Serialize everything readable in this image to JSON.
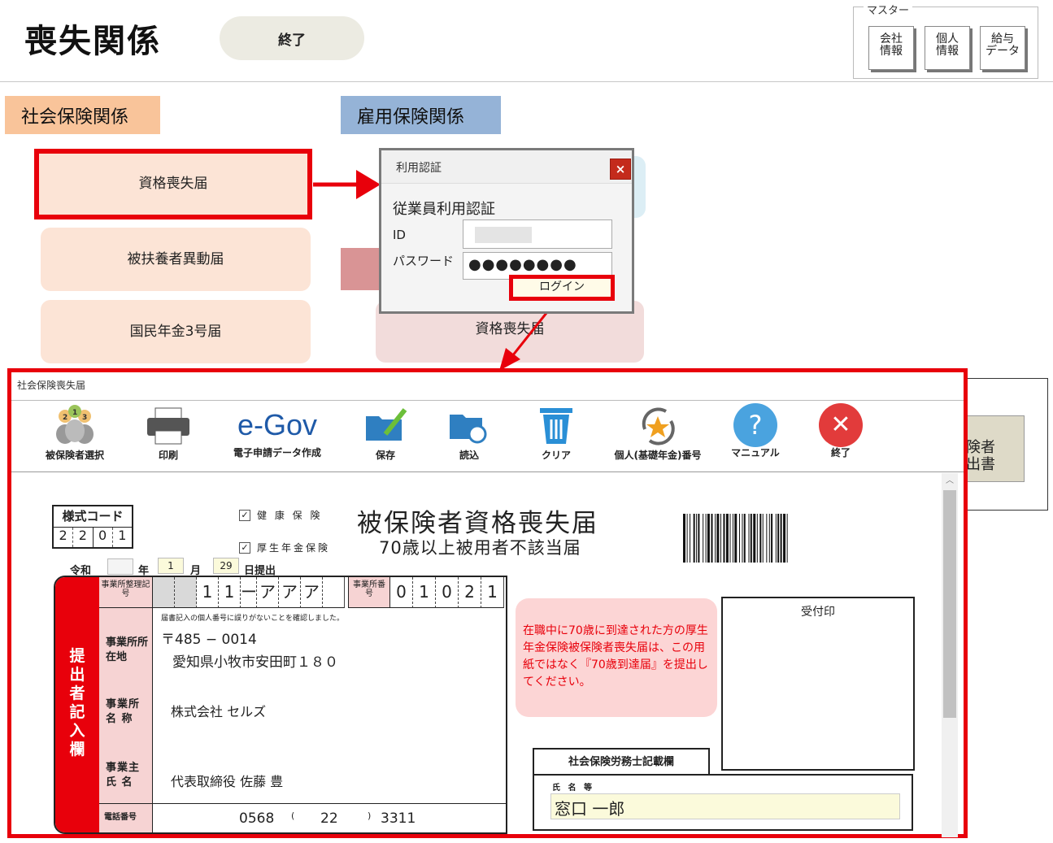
{
  "header": {
    "title": "喪失関係",
    "end_button": "終了",
    "master_label": "マスター",
    "master_buttons": [
      {
        "line1": "会社",
        "line2": "情報"
      },
      {
        "line1": "個人",
        "line2": "情報"
      },
      {
        "line1": "給与",
        "line2": "データ"
      }
    ]
  },
  "sections": {
    "social": "社会保険関係",
    "employment": "雇用保険関係"
  },
  "social_buttons": [
    "資格喪失届",
    "被扶養者異動届",
    "国民年金3号届"
  ],
  "employment_buttons": [
    "資格喪失届"
  ],
  "bg_partial": {
    "line1": "険者",
    "line2": "出書"
  },
  "dialog": {
    "title": "利用認証",
    "close": "×",
    "heading": "従業員利用認証",
    "id_label": "ID",
    "password_label": "パスワード",
    "password_mask": "●●●●●●●●",
    "login": "ログイン"
  },
  "form": {
    "window_title": "社会保険喪失届",
    "toolbar": [
      {
        "label": "被保険者選択",
        "icon": "people-icon"
      },
      {
        "label": "印刷",
        "icon": "printer-icon"
      },
      {
        "label": "電子申請データ作成",
        "icon": "egov-logo",
        "logo_text": "e-Gov"
      },
      {
        "label": "保存",
        "icon": "save-folder-icon"
      },
      {
        "label": "読込",
        "icon": "load-folder-icon"
      },
      {
        "label": "クリア",
        "icon": "trash-icon"
      },
      {
        "label": "個人(基礎年金)番号",
        "icon": "star-cycle-icon"
      },
      {
        "label": "マニュアル",
        "icon": "help-icon",
        "glyph": "?"
      },
      {
        "label": "終了",
        "icon": "close-icon",
        "glyph": "✕"
      }
    ],
    "style_code_label": "様式コード",
    "style_code_digits": [
      "2",
      "2",
      "0",
      "1"
    ],
    "checkbox_health": "健 康 保 険",
    "checkbox_pension": "厚生年金保険",
    "doc_title": "被保険者資格喪失届",
    "doc_subtitle": "70歳以上被用者不該当届",
    "era": "令和",
    "year_value": "",
    "year_label": "年",
    "month_value": "1",
    "month_label": "月",
    "day_value": "29",
    "day_label": "日提出",
    "submitter_band": "提出者記入欄",
    "office_reg_label": "事業所整理記号",
    "office_reg_chars": [
      "",
      "",
      "1",
      "1",
      "ー",
      "ア",
      "ア",
      "ア",
      ""
    ],
    "office_no_label": "事業所番号",
    "office_no_digits": [
      "0",
      "1",
      "0",
      "2",
      "1"
    ],
    "confirm_note": "届書記入の個人番号に誤りがないことを確認しました。",
    "address_label": "事業所所在地",
    "postal": "〒485 − 0014",
    "address": "愛知県小牧市安田町１８０",
    "office_name_label": "事業所名 称",
    "office_name": "株式会社 セルズ",
    "owner_label": "事業主氏 名",
    "owner_name": "代表取締役 佐藤 豊",
    "phone_label": "電話番号",
    "phone_area": "0568",
    "phone_paren_open": "(",
    "phone_mid": "22",
    "phone_paren_close": ")",
    "phone_last": "3311",
    "notice": "在職中に70歳に到達された方の厚生年金保険被保険者喪失届は、この用紙ではなく『70歳到達届』を提出してください。",
    "stamp_label": "受付印",
    "sharoushi_label": "社会保険労務士記載欄",
    "sharoushi_name_label": "氏 名 等",
    "sharoushi_name": "窓口 一郎"
  },
  "colors": {
    "red": "#e8000b",
    "social_header": "#f9c49a",
    "employment_header": "#95b3d7",
    "social_button": "#fce4d6",
    "employment_button": "#f2dcdb",
    "notice_bg": "#fcd5d5"
  }
}
